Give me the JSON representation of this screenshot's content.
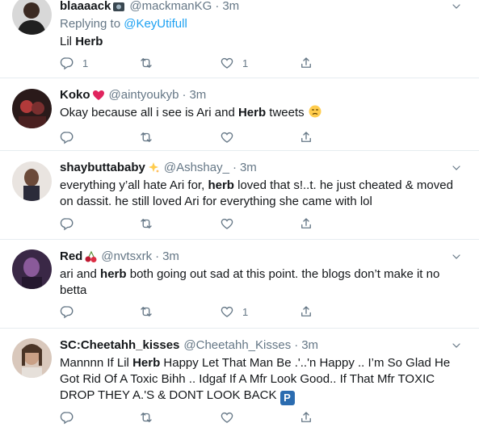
{
  "tweets": [
    {
      "name": "blaaaack",
      "handle": "@mackmanKG",
      "time": "3m",
      "replying_prefix": "Replying to ",
      "replying_to": "@KeyUtifull",
      "text_before": "Lil ",
      "text_bold": "Herb",
      "text_after": "",
      "reply_count": "1",
      "retweet_count": "",
      "like_count": "1"
    },
    {
      "name": "Koko",
      "handle": "@aintyoukyb",
      "time": "3m",
      "text_before": "Okay because all i see is Ari and ",
      "text_bold": "Herb",
      "text_after": " tweets",
      "reply_count": "",
      "retweet_count": "",
      "like_count": ""
    },
    {
      "name": "shaybuttababy",
      "handle": "@Ashshay_",
      "time": "3m",
      "text_before": "everything y’all hate Ari for, ",
      "text_bold": "herb",
      "text_after": " loved that s!..t. he just cheated & moved on dassit. he still loved Ari for everything she came with lol",
      "reply_count": "",
      "retweet_count": "",
      "like_count": ""
    },
    {
      "name": "Red",
      "handle": "@nvtsxrk",
      "time": "3m",
      "text_before": "ari and ",
      "text_bold": "herb",
      "text_after": " both going out sad at this point. the blogs don’t make it no betta",
      "reply_count": "",
      "retweet_count": "",
      "like_count": "1"
    },
    {
      "name": "SC:Cheetahh_kisses",
      "handle": "@Cheetahh_Kisses",
      "time": "3m",
      "text_before": "Mannnn If Lil ",
      "text_bold": "Herb",
      "text_after": " Happy Let That Man Be .'..'n Happy .. I’m So Glad He Got Rid Of A Toxic Bihh .. Idgaf If A Mfr Look Good.. If That Mfr TOXIC DROP THEY A.'S & DONT LOOK BACK",
      "parking_label": "P",
      "reply_count": "",
      "retweet_count": "",
      "like_count": ""
    }
  ],
  "icons": {
    "reply": "reply-icon",
    "retweet": "retweet-icon",
    "like": "heart-icon",
    "share": "share-icon",
    "caret": "chevron-down-icon"
  },
  "colors": {
    "link": "#1da1f2",
    "muted": "#657786",
    "text": "#14171a",
    "divider": "#e6ecf0"
  }
}
